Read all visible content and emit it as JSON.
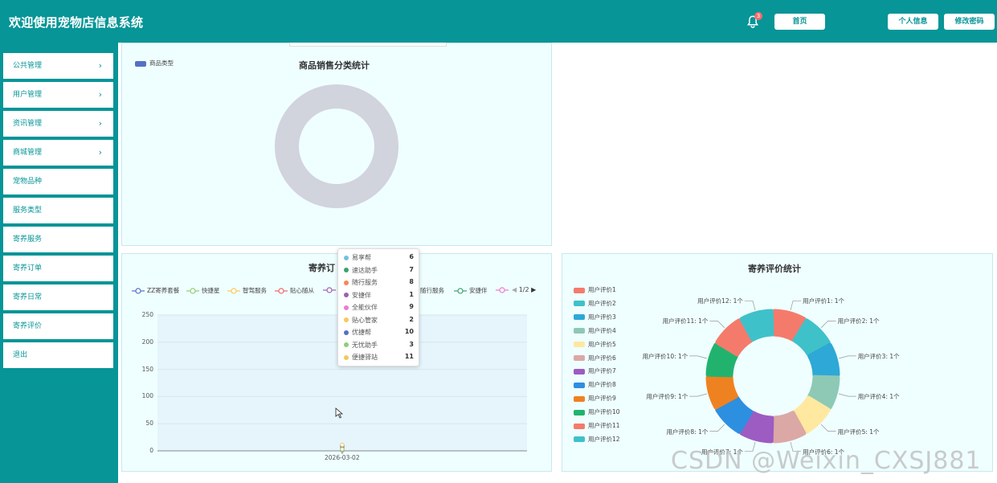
{
  "header": {
    "title": "欢迎使用宠物店信息系统",
    "notify_count": "3",
    "btn_home": "首页",
    "btn_profile": "个人信息",
    "btn_password": "修改密码"
  },
  "sidebar": {
    "items": [
      {
        "label": "公共管理",
        "arrow": "›"
      },
      {
        "label": "用户管理",
        "arrow": "›"
      },
      {
        "label": "资讯管理",
        "arrow": "›"
      },
      {
        "label": "商城管理",
        "arrow": "›"
      },
      {
        "label": "宠物品种"
      },
      {
        "label": "服务类型"
      },
      {
        "label": "寄养服务"
      },
      {
        "label": "寄养订单"
      },
      {
        "label": "寄养日常"
      },
      {
        "label": "寄养评价"
      },
      {
        "label": "退出"
      }
    ]
  },
  "chart1": {
    "title": "商品销售分类统计",
    "legend": "商品类型",
    "color": "#d1d3dd",
    "legend_color": "#5470c6"
  },
  "chart2": {
    "title_visible": "寄养订",
    "legend": [
      "ZZ寄养套餐",
      "快捷星",
      "智驾服务",
      "贴心随从",
      "随行服务",
      "安捷伴"
    ],
    "legend_colors": [
      "#5470c6",
      "#91cc75",
      "#fac858",
      "#ee6666",
      "#73c0de",
      "#3ba272",
      "#9a60b4",
      "#ea7ccc"
    ],
    "pager": "1/2",
    "y_ticks": [
      "250",
      "200",
      "150",
      "100",
      "50",
      "0"
    ],
    "x_label": "2026-03-02",
    "tooltip": [
      {
        "name": "易享帮",
        "value": "6",
        "color": "#73c0de"
      },
      {
        "name": "速达助手",
        "value": "7",
        "color": "#3ba272"
      },
      {
        "name": "随行服务",
        "value": "8",
        "color": "#fc8452"
      },
      {
        "name": "安捷伴",
        "value": "1",
        "color": "#9a60b4"
      },
      {
        "name": "全能伙伴",
        "value": "9",
        "color": "#ea7ccc"
      },
      {
        "name": "贴心管家",
        "value": "2",
        "color": "#fac858"
      },
      {
        "name": "优捷帮",
        "value": "10",
        "color": "#5470c6"
      },
      {
        "name": "无忧助手",
        "value": "3",
        "color": "#91cc75"
      },
      {
        "name": "便捷驿站",
        "value": "11",
        "color": "#f2c85b"
      }
    ]
  },
  "chart3": {
    "title": "寄养评价统计",
    "legend": [
      "用户评价1",
      "用户评价2",
      "用户评价3",
      "用户评价4",
      "用户评价5",
      "用户评价6",
      "用户评价7",
      "用户评价8",
      "用户评价9",
      "用户评价10",
      "用户评价11",
      "用户评价12"
    ],
    "colors": [
      "#f47b6b",
      "#3fc1c9",
      "#2ea8d6",
      "#8dc9b5",
      "#ffe8a0",
      "#dba8a5",
      "#9c5cc1",
      "#2d8fe0",
      "#ef8220",
      "#21b36e",
      "#f47b6b",
      "#3fc1c9"
    ],
    "slice_labels": [
      "用户评价1: 1个",
      "用户评价2: 1个",
      "用户评价3: 1个",
      "用户评价4: 1个",
      "用户评价5: 1个",
      "用户评价6: 1个",
      "用户评价7: 1个",
      "用户评价8: 1个",
      "用户评价9: 1个",
      "用户评价10: 1个",
      "用户评价11: 1个",
      "用户评价12: 1个"
    ]
  },
  "watermark": "CSDN @Weixin_CXSJ881",
  "chart_data": [
    {
      "type": "pie",
      "title": "商品销售分类统计",
      "legend": [
        "商品类型"
      ],
      "values": []
    },
    {
      "type": "line",
      "x": [
        "2026-03-02"
      ],
      "ylim": [
        0,
        250
      ],
      "series": [
        {
          "name": "易享帮",
          "values": [
            6
          ]
        },
        {
          "name": "速达助手",
          "values": [
            7
          ]
        },
        {
          "name": "随行服务",
          "values": [
            8
          ]
        },
        {
          "name": "安捷伴",
          "values": [
            1
          ]
        },
        {
          "name": "全能伙伴",
          "values": [
            9
          ]
        },
        {
          "name": "贴心管家",
          "values": [
            2
          ]
        },
        {
          "name": "优捷帮",
          "values": [
            10
          ]
        },
        {
          "name": "无忧助手",
          "values": [
            3
          ]
        },
        {
          "name": "便捷驿站",
          "values": [
            11
          ]
        }
      ]
    },
    {
      "type": "pie",
      "title": "寄养评价统计",
      "categories": [
        "用户评价1",
        "用户评价2",
        "用户评价3",
        "用户评价4",
        "用户评价5",
        "用户评价6",
        "用户评价7",
        "用户评价8",
        "用户评价9",
        "用户评价10",
        "用户评价11",
        "用户评价12"
      ],
      "values": [
        1,
        1,
        1,
        1,
        1,
        1,
        1,
        1,
        1,
        1,
        1,
        1
      ]
    }
  ]
}
